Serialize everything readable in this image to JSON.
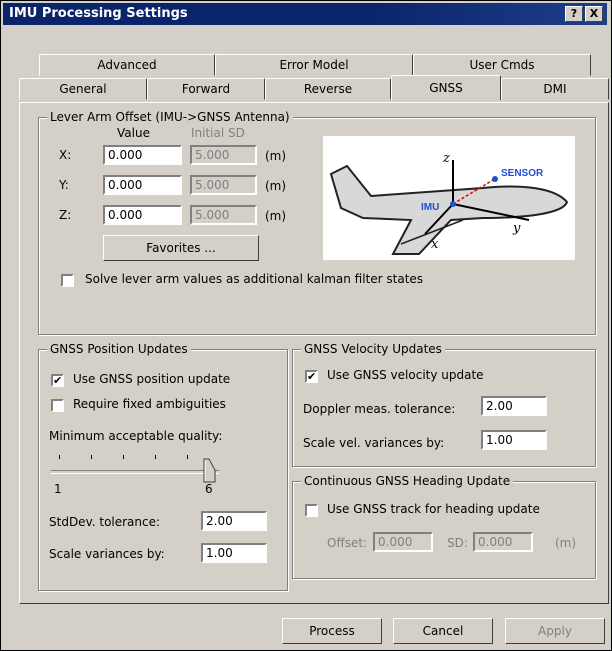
{
  "window": {
    "title": "IMU Processing Settings",
    "help_label": "?",
    "close_label": "X"
  },
  "tabs": {
    "row1": [
      "Advanced",
      "Error Model",
      "User Cmds"
    ],
    "row2": [
      "General",
      "Forward",
      "Reverse",
      "GNSS",
      "DMI"
    ],
    "active": "GNSS"
  },
  "lever_arm": {
    "legend": "Lever Arm Offset (IMU->GNSS Antenna)",
    "value_header": "Value",
    "sd_header": "Initial SD",
    "rows": [
      {
        "axis": "X:",
        "value": "0.000",
        "sd": "5.000",
        "unit": "(m)"
      },
      {
        "axis": "Y:",
        "value": "0.000",
        "sd": "5.000",
        "unit": "(m)"
      },
      {
        "axis": "Z:",
        "value": "0.000",
        "sd": "5.000",
        "unit": "(m)"
      }
    ],
    "favorites_label": "Favorites ...",
    "solve_label": "Solve lever arm values as additional kalman filter states",
    "solve_checked": false,
    "diagram": {
      "z": "z",
      "x": "x",
      "y": "y",
      "imu": "IMU",
      "sensor": "SENSOR"
    }
  },
  "gnss_position": {
    "legend": "GNSS Position Updates",
    "use_label": "Use GNSS position update",
    "use_checked": true,
    "fixed_label": "Require fixed ambiguities",
    "fixed_checked": false,
    "quality_label": "Minimum acceptable quality:",
    "quality_value": 6,
    "quality_min": "1",
    "quality_max": "6",
    "stddev_label": "StdDev. tolerance:",
    "stddev_value": "2.00",
    "scale_label": "Scale variances by:",
    "scale_value": "1.00"
  },
  "gnss_velocity": {
    "legend": "GNSS Velocity Updates",
    "use_label": "Use GNSS velocity update",
    "use_checked": true,
    "doppler_label": "Doppler meas. tolerance:",
    "doppler_value": "2.00",
    "scale_label": "Scale vel. variances by:",
    "scale_value": "1.00"
  },
  "heading": {
    "legend": "Continuous GNSS Heading Update",
    "use_label": "Use GNSS track for heading update",
    "use_checked": false,
    "offset_label": "Offset:",
    "offset_value": "0.000",
    "sd_label": "SD:",
    "sd_value": "0.000",
    "unit": "(m)"
  },
  "footer": {
    "process": "Process",
    "cancel": "Cancel",
    "apply": "Apply"
  }
}
